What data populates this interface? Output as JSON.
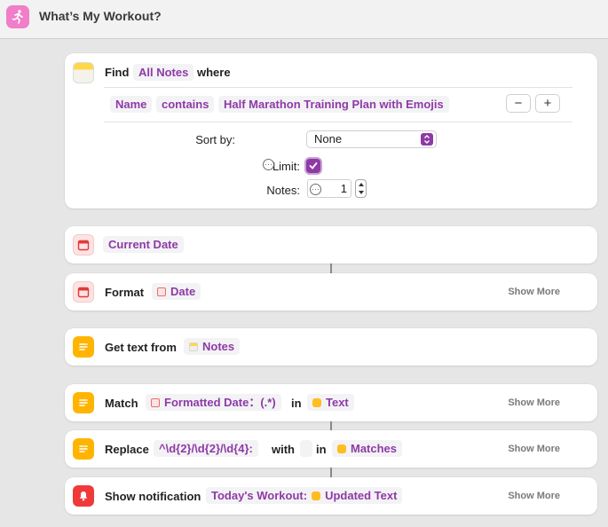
{
  "window": {
    "title": "What’s My Workout?",
    "app_icon": "runner-icon",
    "icon_color": "#f07ec9"
  },
  "accent": "#8e3aa6",
  "find": {
    "label": "Find",
    "source": "All Notes",
    "where": "where",
    "filter": {
      "field": "Name",
      "op": "contains",
      "value": "Half Marathon Training Plan with Emojis"
    },
    "remove_symbol": "−",
    "add_symbol": "+",
    "sort_label": "Sort by:",
    "sort_value": "None",
    "limit_label": "Limit:",
    "limit_checked": true,
    "notes_label": "Notes:",
    "notes_value": "1"
  },
  "current_date": {
    "token": "Current Date"
  },
  "format": {
    "label": "Format",
    "token": "Date",
    "show_more": "Show More"
  },
  "get_text": {
    "label": "Get text from",
    "token": "Notes"
  },
  "match": {
    "label": "Match",
    "token": "Formatted Date：(.*)",
    "in_label": "in",
    "in_token": "Text",
    "show_more": "Show More"
  },
  "replace": {
    "label": "Replace",
    "pattern": "^\\d{2}/\\d{2}/\\d{4}:",
    "with_label": "with",
    "with_value": "",
    "in_label": "in",
    "in_token": "Matches",
    "show_more": "Show More"
  },
  "notify": {
    "label": "Show notification",
    "text": "Today's Workout:",
    "token": "Updated Text",
    "show_more": "Show More"
  }
}
